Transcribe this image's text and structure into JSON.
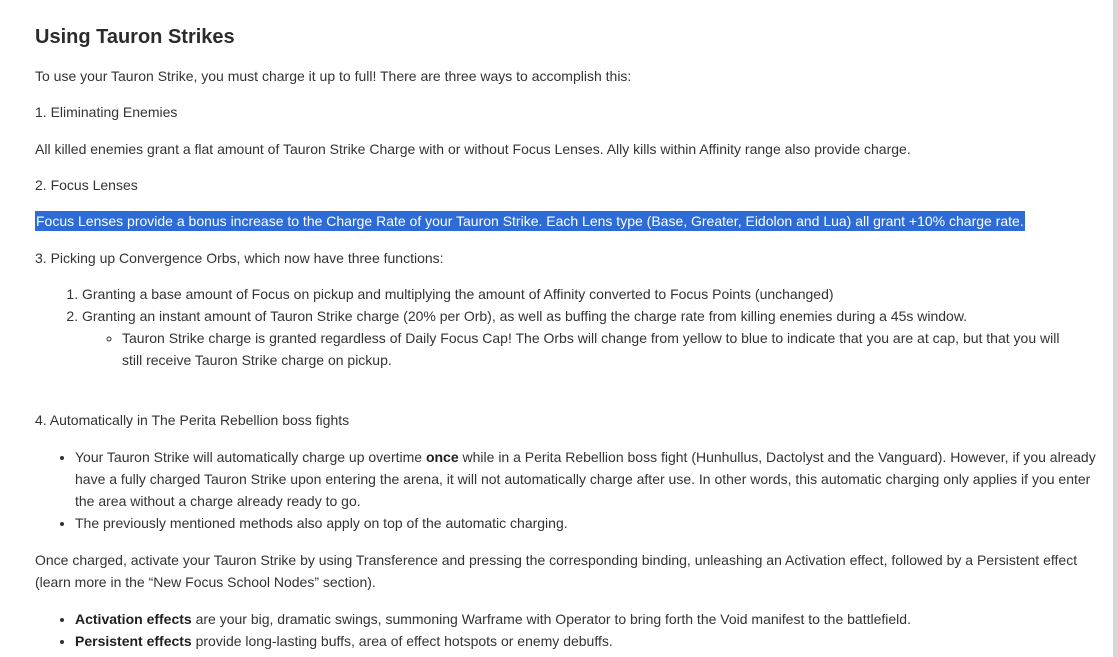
{
  "heading": "Using Tauron Strikes",
  "intro": "To use your Tauron Strike, you must charge it up to full! There are three ways to accomplish this:",
  "s1_title": "1. Eliminating Enemies",
  "s1_body": "All killed enemies grant a flat amount of Tauron Strike Charge with or without Focus Lenses. Ally kills within Affinity range also provide charge.",
  "s2_title": "2. Focus Lenses",
  "s2_body": "Focus Lenses provide a bonus increase to the Charge Rate of your Tauron Strike. Each Lens type (Base, Greater, Eidolon and Lua) all grant +10% charge rate.",
  "s3_title": "3. Picking up Convergence Orbs, which now have three functions:",
  "s3_items": {
    "i1": "Granting a base amount of Focus on pickup and multiplying the amount of Affinity converted to Focus Points (unchanged)",
    "i2": "Granting an instant amount of Tauron Strike charge (20% per Orb), as well as buffing the charge rate from killing enemies during a 45s window.",
    "i2_sub": "Tauron Strike charge is granted regardless of Daily Focus Cap! The Orbs will change from yellow to blue to indicate that you are at cap, but that you will still receive Tauron Strike charge on pickup."
  },
  "s4_title": "4. Automatically in The Perita Rebellion boss fights",
  "s4_items": {
    "b1_pre": "Your Tauron Strike will automatically charge up overtime ",
    "b1_bold": "once",
    "b1_post": " while in a Perita Rebellion  boss fight (Hunhullus, Dactolyst and the Vanguard). However, if you already have a fully charged Tauron Strike upon entering the arena, it will not automatically charge after use. In other words, this automatic charging only applies if you enter the area without a charge already ready to go.",
    "b2": "The previously mentioned methods also apply on top of the automatic charging."
  },
  "outro": "Once charged, activate your Tauron Strike by using Transference and pressing the corresponding binding, unleashing an Activation effect, followed by a Persistent effect (learn more in the “New Focus School Nodes” section).",
  "effects": {
    "activation_bold": "Activation effects",
    "activation_rest": " are your big, dramatic swings, summoning Warframe with Operator to bring forth the Void manifest to the battlefield.",
    "persistent_bold": "Persistent effects",
    "persistent_rest": " provide long-lasting buffs, area of effect hotspots or enemy debuffs."
  }
}
